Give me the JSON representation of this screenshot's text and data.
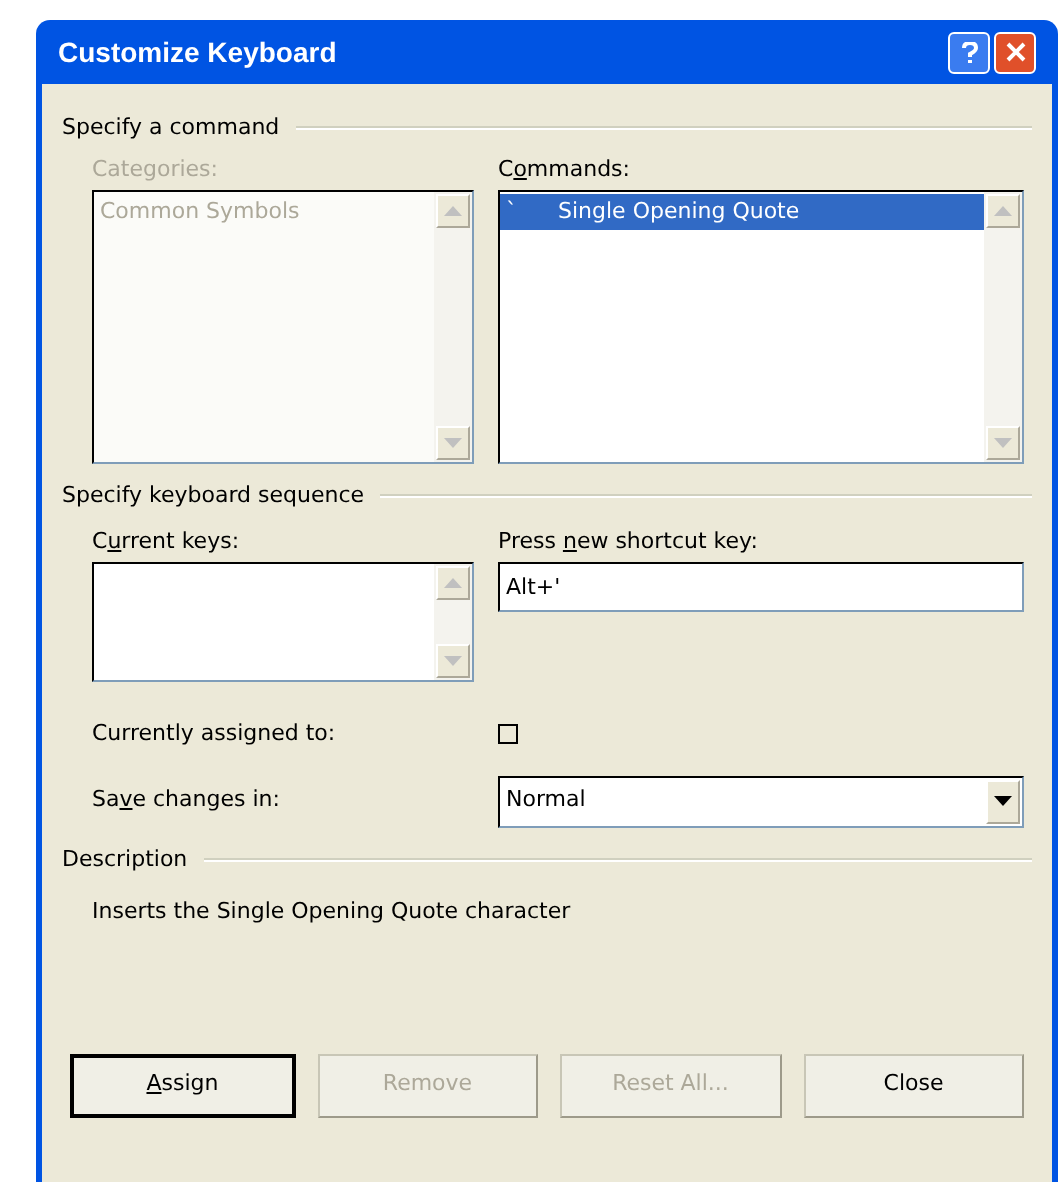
{
  "window": {
    "title": "Customize Keyboard"
  },
  "command_group": {
    "title": "Specify a command",
    "categories": {
      "label": "Categories:",
      "disabled": true,
      "items": [
        {
          "text": "Common Symbols",
          "selected": false
        }
      ]
    },
    "commands": {
      "label_before": "C",
      "access_key": "o",
      "label_after": "mmands:",
      "items": [
        {
          "icon": "`",
          "text": "Single Opening Quote",
          "selected": true
        }
      ]
    }
  },
  "keyboard_group": {
    "title": "Specify keyboard sequence",
    "current_keys": {
      "label_before": "C",
      "access_key": "u",
      "label_after": "rrent keys:"
    },
    "new_shortcut": {
      "label_before": "Press ",
      "access_key": "n",
      "label_after": "ew shortcut key:",
      "value": "Alt+'"
    },
    "assigned": {
      "label": "Currently assigned to:",
      "checked": false
    },
    "save_in": {
      "label_before": "Sa",
      "access_key": "v",
      "label_after": "e changes in:",
      "value": "Normal"
    }
  },
  "description": {
    "title": "Description",
    "text": "Inserts the Single Opening Quote character"
  },
  "buttons": [
    {
      "access_key": "A",
      "label_after": "ssign",
      "disabled": false,
      "default": true
    },
    {
      "label": "Remove",
      "disabled": true,
      "default": false
    },
    {
      "label": "Reset All...",
      "disabled": true,
      "default": false
    },
    {
      "label": "Close",
      "disabled": false,
      "default": false
    }
  ]
}
